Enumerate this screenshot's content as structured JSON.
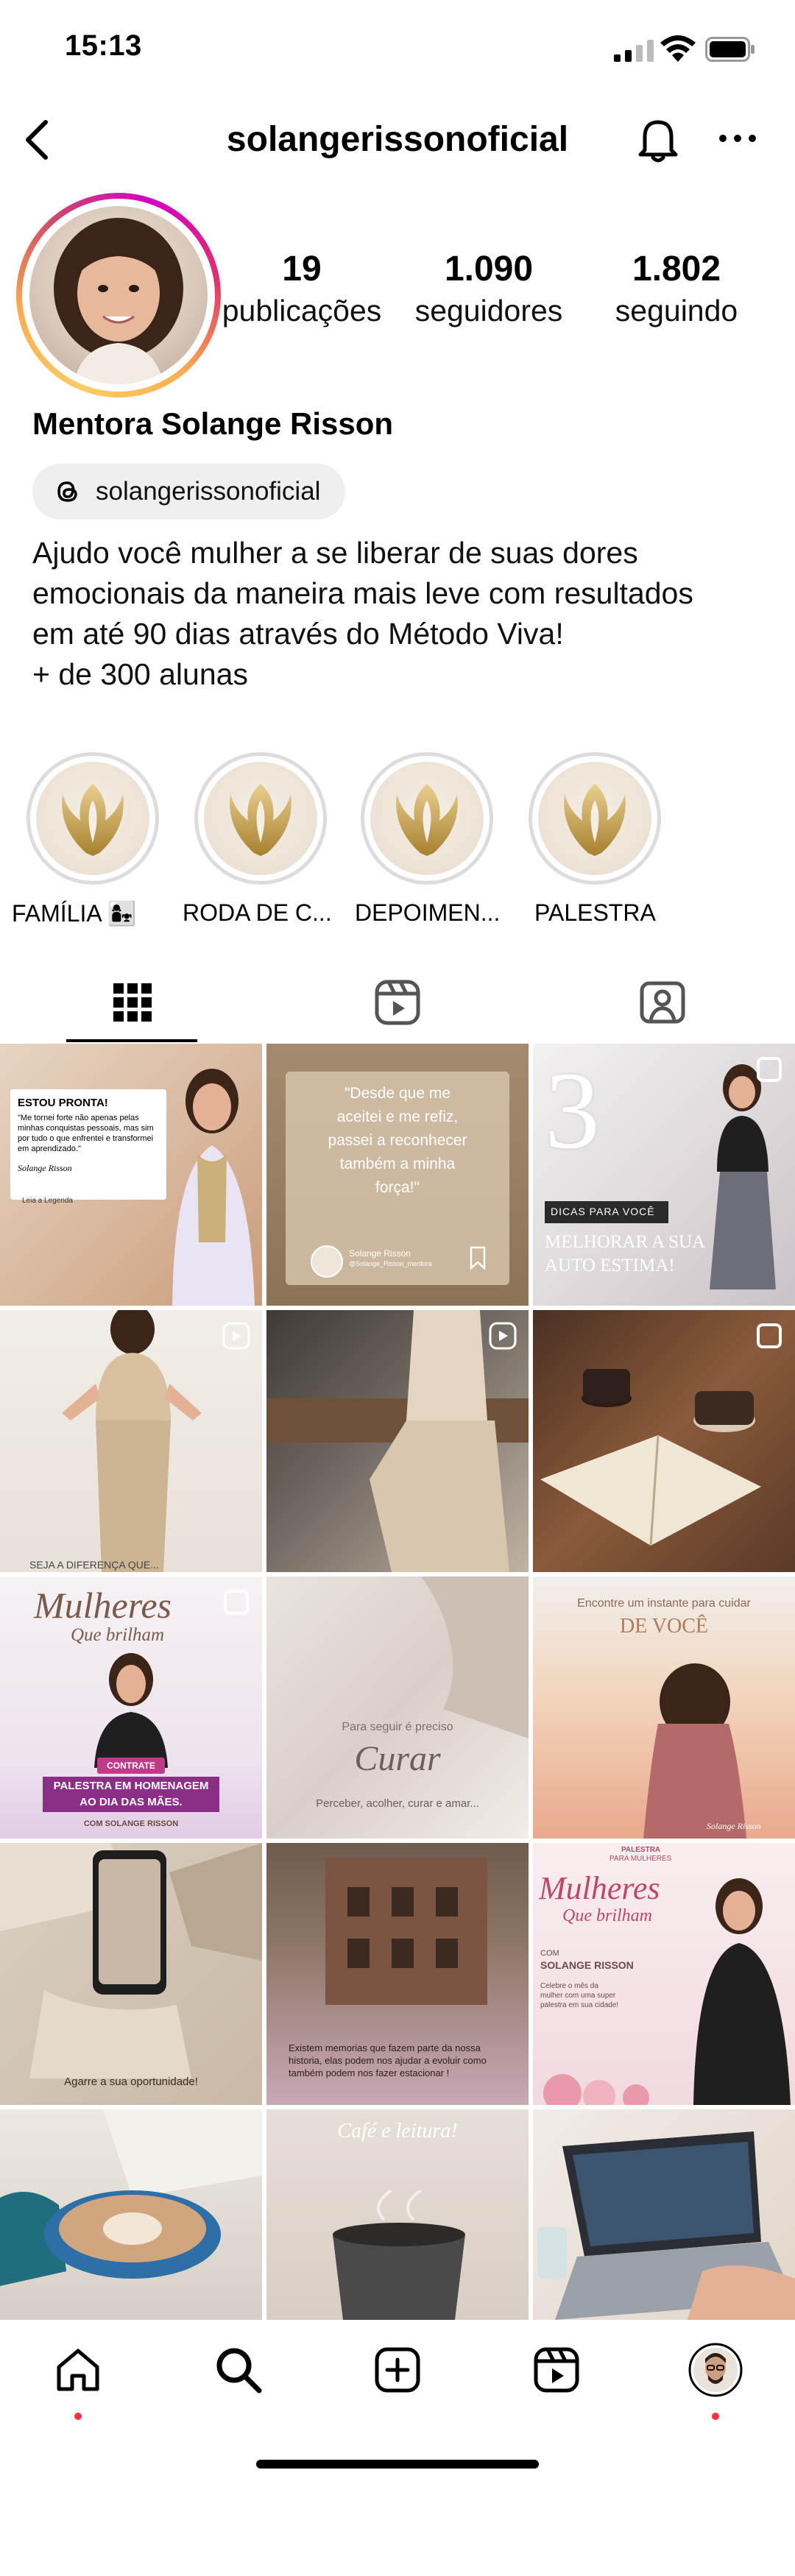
{
  "status_bar": {
    "time": "15:13"
  },
  "header": {
    "username": "solangerissonoficial",
    "back_icon": "chevron-left-icon",
    "bell_icon": "bell-icon",
    "more_icon": "more-horizontal-icon"
  },
  "profile": {
    "stats": [
      {
        "value": "19",
        "label": "publicações"
      },
      {
        "value": "1.090",
        "label": "seguidores"
      },
      {
        "value": "1.802",
        "label": "seguindo"
      }
    ],
    "display_name": "Mentora Solange Risson",
    "threads_handle": "solangerissonoficial",
    "bio_lines": [
      "Ajudo você mulher a se liberar de suas dores",
      "emocionais da maneira mais leve com resultados",
      "em até 90 dias através do Método Viva!",
      "+ de 300 alunas"
    ]
  },
  "highlights": [
    {
      "label": "FAMÍLIA 👩‍👧"
    },
    {
      "label": "RODA DE C..."
    },
    {
      "label": "DEPOIMEN..."
    },
    {
      "label": "PALESTRA"
    }
  ],
  "tabs": [
    {
      "name": "posts",
      "icon": "grid-icon",
      "active": true
    },
    {
      "name": "reels",
      "icon": "reels-icon",
      "active": false
    },
    {
      "name": "tagged",
      "icon": "tagged-person-icon",
      "active": false
    }
  ],
  "posts": {
    "p1": {
      "title": "ESTOU PRONTA!",
      "quote": "\"Me tornei forte não apenas pelas minhas conquistas pessoais, mas sim por tudo o que enfrentei e transformei em aprendizado.\"",
      "author": "Solange Risson",
      "footer": "Leia a Legenda"
    },
    "p2": {
      "lines": [
        "\"Desde que me",
        "aceitei e me refiz,",
        "passei a reconhecer",
        "também a minha",
        "força!\""
      ],
      "name": "Solange Risson",
      "handle": "@Solange_Risson_mentora"
    },
    "p3": {
      "number": "3",
      "tag": "DICAS PARA VOCÊ",
      "line1": "MELHORAR A SUA",
      "line2": "AUTO ESTIMA!"
    },
    "p4": {
      "caption": "SEJA A DIFERENÇA QUE..."
    },
    "p7": {
      "title1": "Mulheres",
      "title2": "Que brilham",
      "tag": "CONTRATE",
      "banner1": "PALESTRA EM HOMENAGEM",
      "banner2": "AO DIA DAS MÃES.",
      "footer": "COM SOLANGE RISSON"
    },
    "p8": {
      "small": "Para seguir é preciso",
      "big": "Curar",
      "caption": "Perceber, acolher, curar e amar..."
    },
    "p9": {
      "top": "Encontre um instante para cuidar",
      "big": "DE VOCÊ",
      "sign": "Solange Risson"
    },
    "p10": {
      "caption": "Agarre a sua oportunidade!"
    },
    "p11": {
      "caption": "Existem memorias que fazem parte da nossa historia, elas podem nos ajudar a evoluir como também podem nos fazer estacionar !"
    },
    "p12": {
      "tag1": "PALESTRA",
      "tag2": "PARA MULHERES",
      "title1": "Mulheres",
      "title2": "Que brilham",
      "com": "COM",
      "name": "SOLANGE RISSON",
      "desc": "Celebre o mês da mulher com uma super palestra em sua cidade!"
    },
    "p14": {
      "caption": "Café e leitura!"
    }
  },
  "bottom_nav": [
    {
      "name": "home",
      "icon": "home-icon"
    },
    {
      "name": "search",
      "icon": "search-icon"
    },
    {
      "name": "create",
      "icon": "plus-square-icon"
    },
    {
      "name": "reels",
      "icon": "reels-icon"
    },
    {
      "name": "profile",
      "icon": "avatar-icon"
    }
  ],
  "colors": {
    "story_ring": "#d300c5",
    "notification_dot": "#ff3040",
    "chip_bg": "#efefef"
  }
}
